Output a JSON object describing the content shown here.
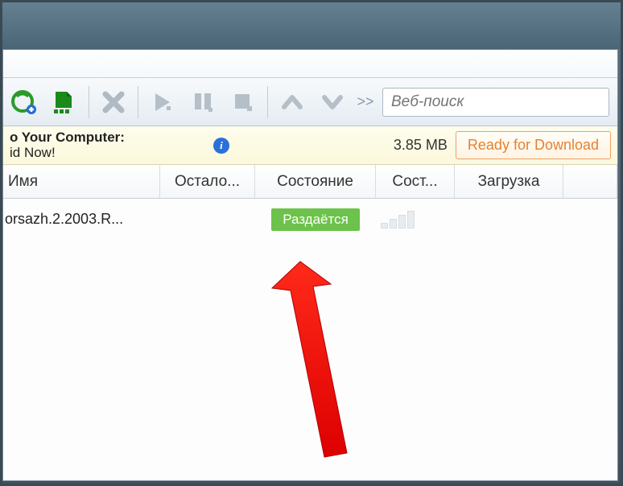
{
  "toolbar": {
    "search_placeholder": "Веб-поиск"
  },
  "banner": {
    "line1": "o Your Computer:",
    "line2": "id Now!",
    "size": "3.85 MB",
    "button": "Ready for Download"
  },
  "columns": {
    "name": "Имя",
    "remaining": "Остало...",
    "state": "Состояние",
    "status": "Сост...",
    "download": "Загрузка"
  },
  "rows": [
    {
      "name": "orsazh.2.2003.R...",
      "state": "Раздаётся"
    }
  ],
  "icons": {
    "add_link": "add-link-icon",
    "add_torrent": "add-torrent-icon",
    "remove": "remove-icon",
    "start": "start-icon",
    "pause": "pause-icon",
    "stop": "stop-icon",
    "move_up": "move-up-icon",
    "move_down": "move-down-icon",
    "overflow": ">>"
  }
}
